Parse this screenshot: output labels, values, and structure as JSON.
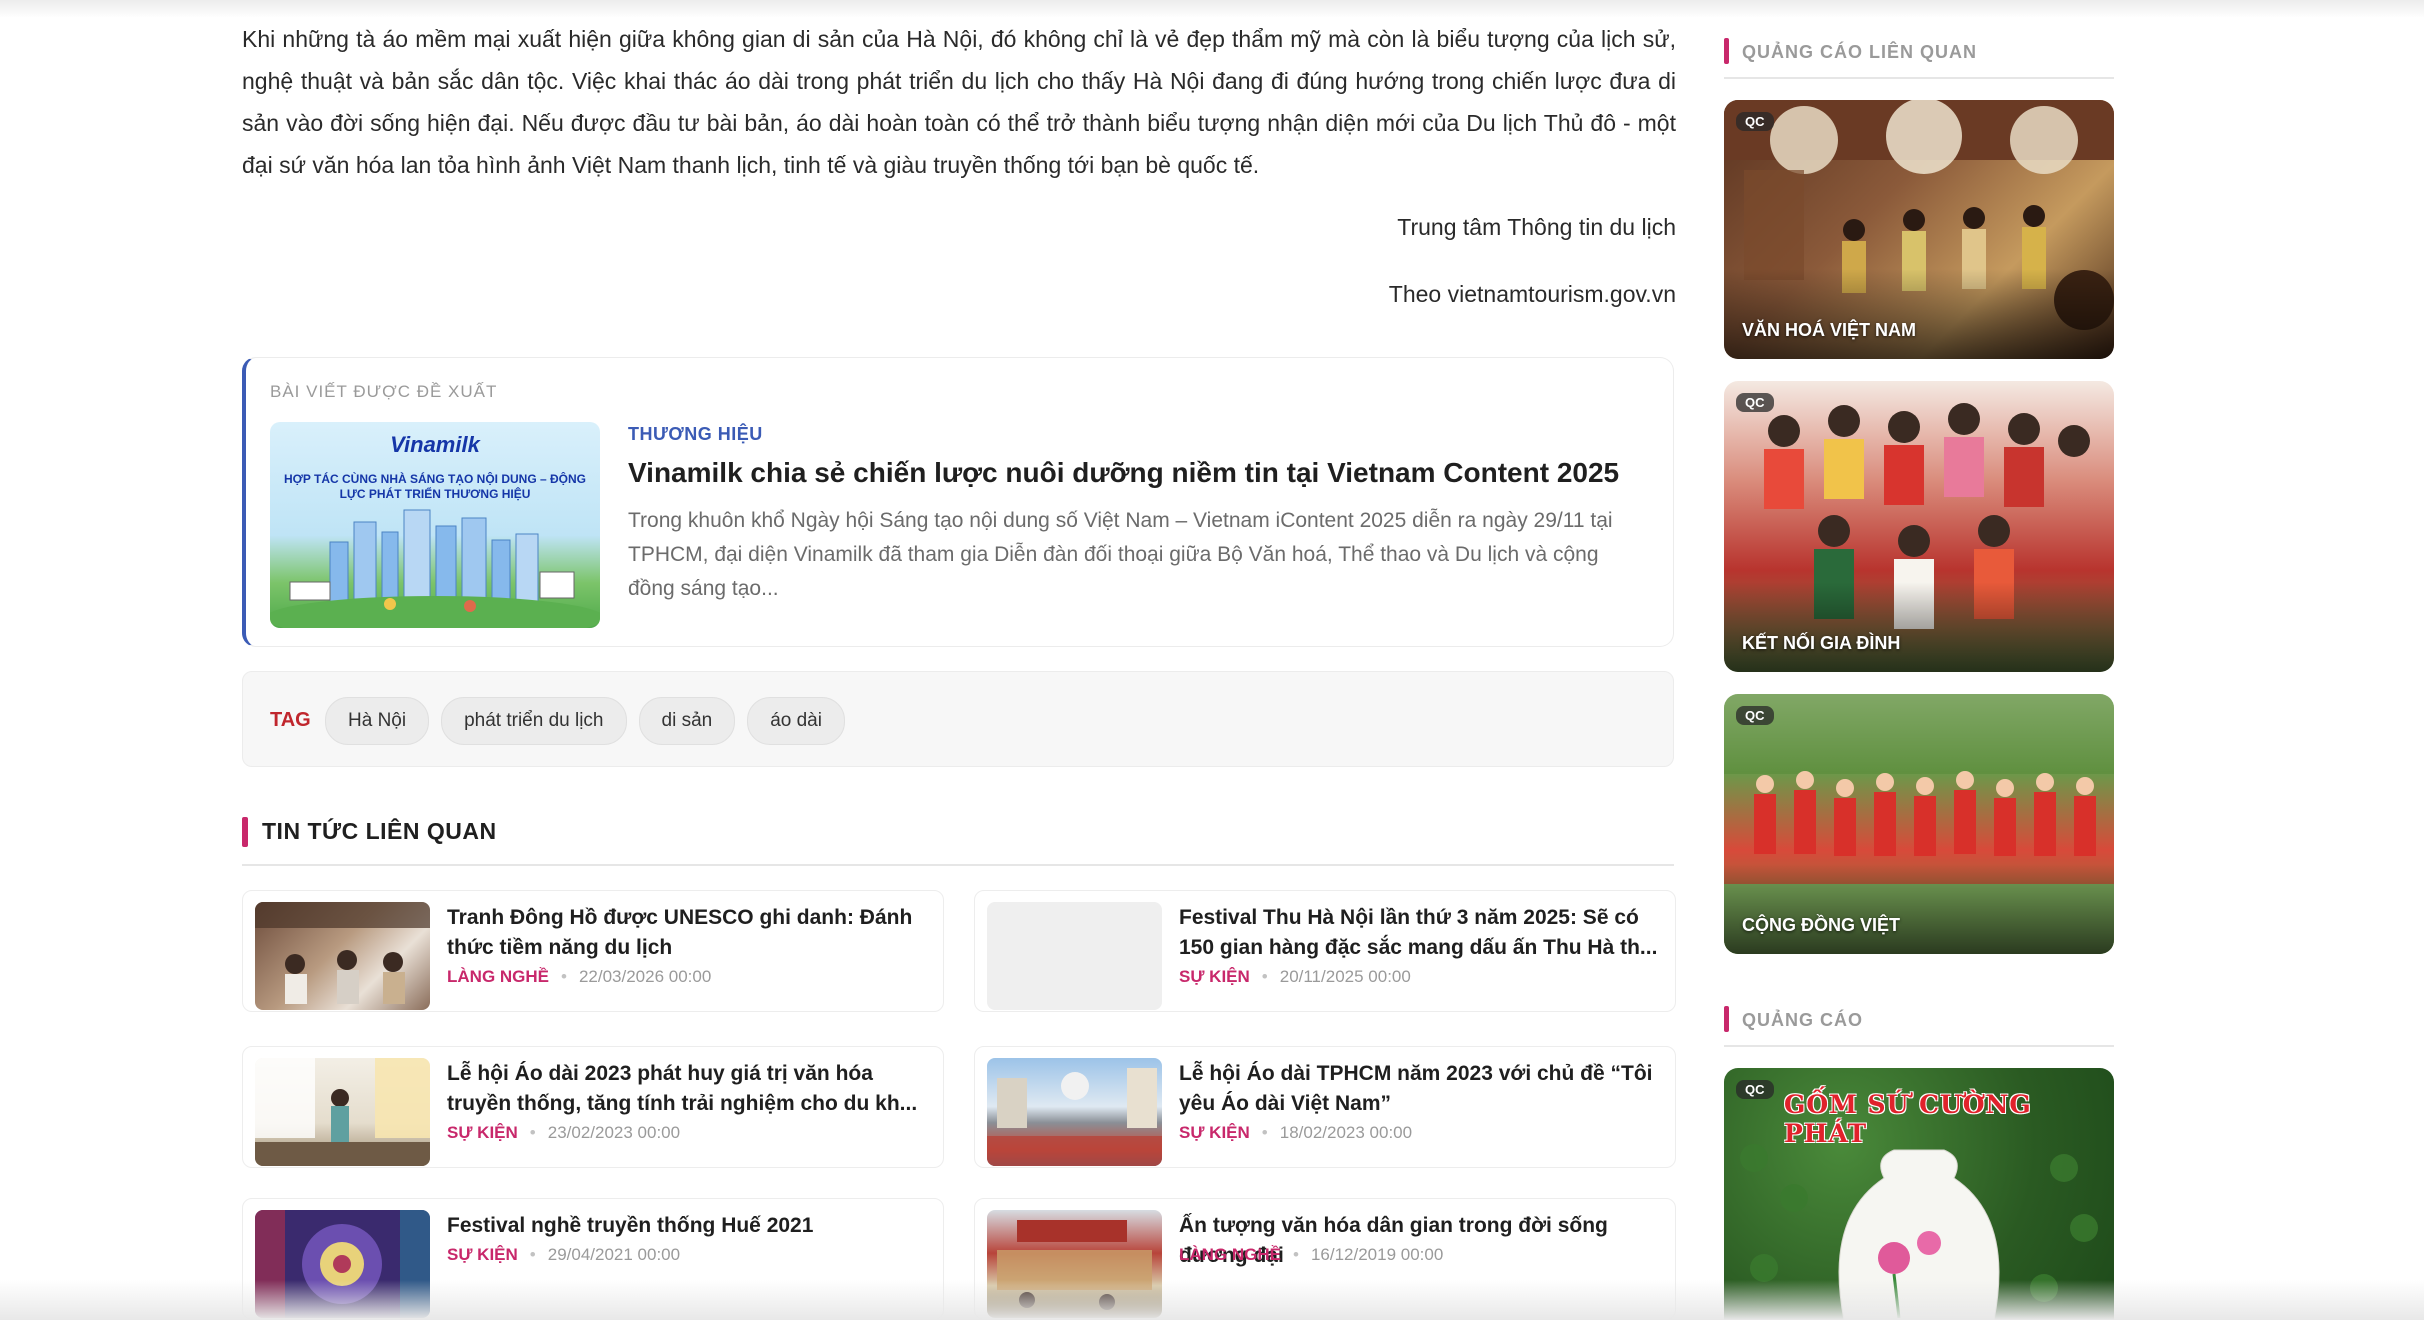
{
  "article": {
    "paragraph": "Khi những tà áo mềm mại xuất hiện giữa không gian di sản của Hà Nội, đó không chỉ là vẻ đẹp thẩm mỹ mà còn là biểu tượng của lịch sử, nghệ thuật và bản sắc dân tộc. Việc khai thác áo dài trong phát triển du lịch cho thấy Hà Nội đang đi đúng hướng trong chiến lược đưa di sản vào đời sống hiện đại. Nếu được đầu tư bài bản, áo dài hoàn toàn có thể trở thành biểu tượng nhận diện mới của Du lịch Thủ đô - một đại sứ văn hóa lan tỏa hình ảnh Việt Nam thanh lịch, tinh tế và giàu truyền thống tới bạn bè quốc tế.",
    "signature_org": "Trung tâm Thông tin du lịch",
    "signature_source": "Theo vietnamtourism.gov.vn"
  },
  "recommended": {
    "label": "BÀI VIẾT ĐƯỢC ĐỀ XUẤT",
    "thumb_logo": "Vinamilk",
    "thumb_slogan": "HỢP TÁC CÙNG NHÀ SÁNG TẠO NỘI DUNG – ĐỘNG LỰC PHÁT TRIỂN THƯƠNG HIỆU",
    "category": "THƯƠNG HIỆU",
    "title": "Vinamilk chia sẻ chiến lược nuôi dưỡng niềm tin tại Vietnam Content 2025",
    "description": "Trong khuôn khổ Ngày hội Sáng tạo nội dung số Việt Nam – Vietnam iContent 2025 diễn ra ngày 29/11 tại TPHCM, đại diện Vinamilk đã tham gia Diễn đàn đối thoại giữa Bộ Văn hoá, Thể thao và Du lịch và cộng đồng sáng tạo..."
  },
  "tags": {
    "label": "TAG",
    "items": [
      "Hà Nội",
      "phát triển du lịch",
      "di sản",
      "áo dài"
    ]
  },
  "related": {
    "heading": "TIN TỨC LIÊN QUAN",
    "items": [
      {
        "title": "Tranh Đông Hồ được UNESCO ghi danh: Đánh thức tiềm năng du lịch",
        "category": "LÀNG NGHỀ",
        "date": "22/03/2026 00:00"
      },
      {
        "title": "Festival Thu Hà Nội lần thứ 3 năm 2025: Sẽ có 150 gian hàng đặc sắc mang dấu ấn Thu Hà th...",
        "category": "SỰ KIỆN",
        "date": "20/11/2025 00:00"
      },
      {
        "title": "Lễ hội Áo dài 2023 phát huy giá trị văn hóa truyền thống, tăng tính trải nghiệm cho du kh...",
        "category": "SỰ KIỆN",
        "date": "23/02/2023 00:00"
      },
      {
        "title": "Lễ hội Áo dài TPHCM năm 2023 với chủ đề “Tôi yêu Áo dài Việt Nam”",
        "category": "SỰ KIỆN",
        "date": "18/02/2023 00:00"
      },
      {
        "title": "Festival nghề truyền thống Huế 2021",
        "category": "SỰ KIỆN",
        "date": "29/04/2021 00:00"
      },
      {
        "title": "Ấn tượng văn hóa dân gian trong đời sống đương đại",
        "category": "LÀNG NGHỀ",
        "date": "16/12/2019 00:00"
      }
    ]
  },
  "sidebar": {
    "related_ads_heading": "QUẢNG CÁO LIÊN QUAN",
    "ads_heading": "QUẢNG CÁO",
    "ad_badge": "QC",
    "related_ads": [
      {
        "caption": "VĂN HOÁ VIỆT NAM"
      },
      {
        "caption": "KẾT NỐI GIA ĐÌNH"
      },
      {
        "caption": "CỘNG ĐỒNG VIỆT"
      }
    ],
    "brand_ad": {
      "brand": "GỐM SỨ CƯỜNG PHÁT"
    }
  },
  "colors": {
    "accent": "#c8286b",
    "link_blue": "#3b5bb5",
    "tag_red": "#c0262d"
  }
}
